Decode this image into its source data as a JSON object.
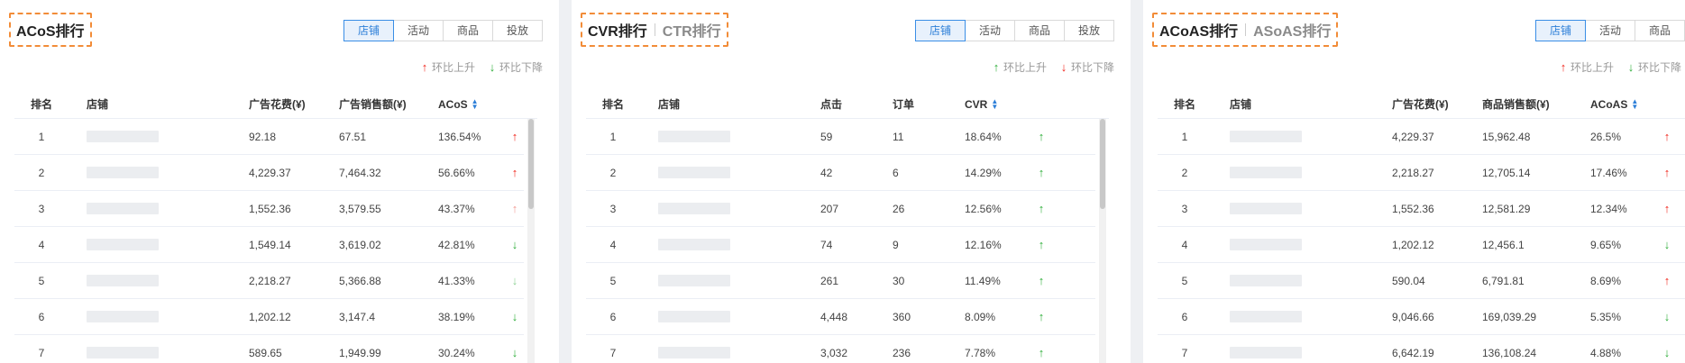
{
  "panels": [
    {
      "title_main": "ACoS排行",
      "title_alt": "",
      "tabs": [
        "店铺",
        "活动",
        "商品",
        "投放"
      ],
      "active_tab": 0,
      "legend": {
        "up": "环比上升",
        "down": "环比下降"
      },
      "headers": [
        "排名",
        "店铺",
        "广告花费(¥)",
        "广告销售额(¥)",
        "ACoS"
      ],
      "rows": [
        {
          "rank": "1",
          "a": "92.18",
          "b": "67.51",
          "m": "136.54%",
          "trend": "up"
        },
        {
          "rank": "2",
          "a": "4,229.37",
          "b": "7,464.32",
          "m": "56.66%",
          "trend": "up"
        },
        {
          "rank": "3",
          "a": "1,552.36",
          "b": "3,579.55",
          "m": "43.37%",
          "trend": "up-light"
        },
        {
          "rank": "4",
          "a": "1,549.14",
          "b": "3,619.02",
          "m": "42.81%",
          "trend": "down"
        },
        {
          "rank": "5",
          "a": "2,218.27",
          "b": "5,366.88",
          "m": "41.33%",
          "trend": "down-light"
        },
        {
          "rank": "6",
          "a": "1,202.12",
          "b": "3,147.4",
          "m": "38.19%",
          "trend": "down"
        },
        {
          "rank": "7",
          "a": "589.65",
          "b": "1,949.99",
          "m": "30.24%",
          "trend": "down"
        }
      ]
    },
    {
      "title_main": "CVR排行",
      "title_alt": "CTR排行",
      "tabs": [
        "店铺",
        "活动",
        "商品",
        "投放"
      ],
      "active_tab": 0,
      "legend": {
        "up": "环比上升",
        "down": "环比下降"
      },
      "headers": [
        "排名",
        "店铺",
        "点击",
        "订单",
        "CVR"
      ],
      "rows": [
        {
          "rank": "1",
          "a": "59",
          "b": "11",
          "m": "18.64%",
          "trend": "green-up"
        },
        {
          "rank": "2",
          "a": "42",
          "b": "6",
          "m": "14.29%",
          "trend": "green-up"
        },
        {
          "rank": "3",
          "a": "207",
          "b": "26",
          "m": "12.56%",
          "trend": "green-up"
        },
        {
          "rank": "4",
          "a": "74",
          "b": "9",
          "m": "12.16%",
          "trend": "green-up"
        },
        {
          "rank": "5",
          "a": "261",
          "b": "30",
          "m": "11.49%",
          "trend": "green-up"
        },
        {
          "rank": "6",
          "a": "4,448",
          "b": "360",
          "m": "8.09%",
          "trend": "green-up"
        },
        {
          "rank": "7",
          "a": "3,032",
          "b": "236",
          "m": "7.78%",
          "trend": "green-up"
        }
      ]
    },
    {
      "title_main": "ACoAS排行",
      "title_alt": "ASoAS排行",
      "tabs": [
        "店铺",
        "活动",
        "商品"
      ],
      "active_tab": 0,
      "legend": {
        "up": "环比上升",
        "down": "环比下降"
      },
      "headers": [
        "排名",
        "店铺",
        "广告花费(¥)",
        "商品销售额(¥)",
        "ACoAS"
      ],
      "rows": [
        {
          "rank": "1",
          "a": "4,229.37",
          "b": "15,962.48",
          "m": "26.5%",
          "trend": "up"
        },
        {
          "rank": "2",
          "a": "2,218.27",
          "b": "12,705.14",
          "m": "17.46%",
          "trend": "up"
        },
        {
          "rank": "3",
          "a": "1,552.36",
          "b": "12,581.29",
          "m": "12.34%",
          "trend": "up"
        },
        {
          "rank": "4",
          "a": "1,202.12",
          "b": "12,456.1",
          "m": "9.65%",
          "trend": "down"
        },
        {
          "rank": "5",
          "a": "590.04",
          "b": "6,791.81",
          "m": "8.69%",
          "trend": "up"
        },
        {
          "rank": "6",
          "a": "9,046.66",
          "b": "169,039.29",
          "m": "5.35%",
          "trend": "down"
        },
        {
          "rank": "7",
          "a": "6,642.19",
          "b": "136,108.24",
          "m": "4.88%",
          "trend": "down"
        }
      ]
    }
  ]
}
